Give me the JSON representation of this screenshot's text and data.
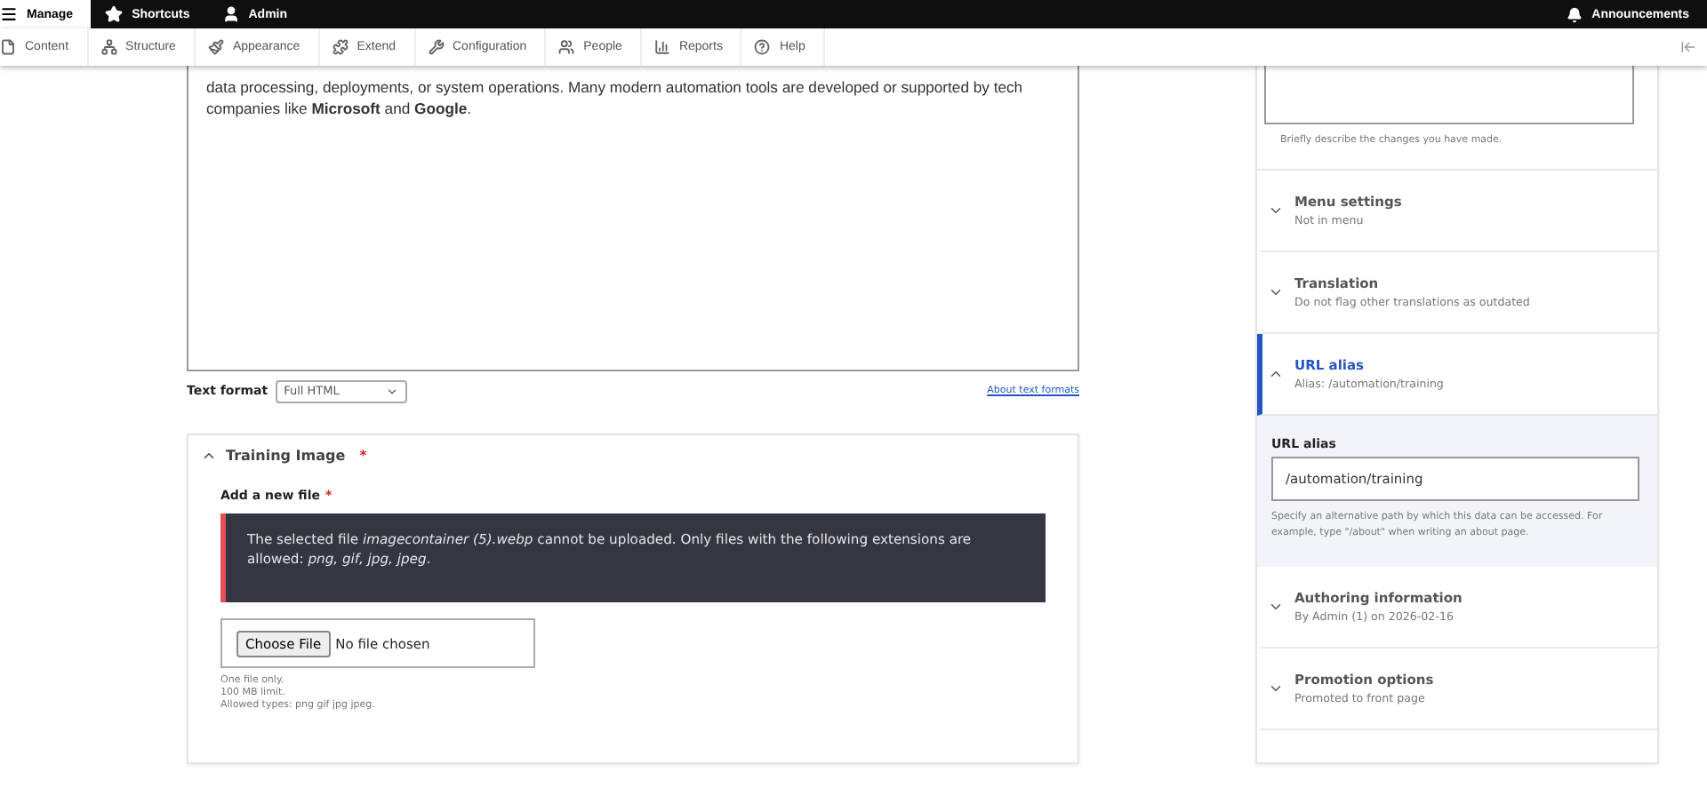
{
  "top_bar": {
    "items": [
      {
        "label": "Manage",
        "kind": "menu",
        "selected": true
      },
      {
        "label": "Shortcuts",
        "kind": "star",
        "selected": false
      },
      {
        "label": "Admin",
        "kind": "user",
        "selected": false
      }
    ],
    "announcements": {
      "label": "Announcements"
    }
  },
  "admin_menu": [
    {
      "label": "Content",
      "kind": "content"
    },
    {
      "label": "Structure",
      "kind": "structure"
    },
    {
      "label": "Appearance",
      "kind": "appearance"
    },
    {
      "label": "Extend",
      "kind": "extend"
    },
    {
      "label": "Configuration",
      "kind": "configuration"
    },
    {
      "label": "People",
      "kind": "people"
    },
    {
      "label": "Reports",
      "kind": "reports"
    },
    {
      "label": "Help",
      "kind": "help"
    }
  ],
  "editor": {
    "text": "data processing, deployments, or system operations. Many modern automation tools are developed or supported by tech companies like **Microsoft** and **Google**."
  },
  "text_format": {
    "label": "Text format",
    "value": "Full HTML",
    "link": "About text formats"
  },
  "training_image": {
    "title": "Training Image",
    "required_marker": "*",
    "expanded": true,
    "field_label": "Add a new file",
    "field_required_marker": "*",
    "error": "The selected file *imagecontainer (5).webp* cannot be uploaded. Only files with the following extensions are allowed: *png, gif, jpg, jpeg*.",
    "button": "Choose File",
    "file_status": "No file chosen",
    "help": [
      "One file only.",
      "100 MB limit.",
      "Allowed types: png gif jpg jpeg."
    ]
  },
  "sidebar": {
    "revision_hint": "Briefly describe the changes you have made.",
    "sections": [
      {
        "title": "Menu settings",
        "summary": "Not in menu",
        "expanded": false
      },
      {
        "title": "Translation",
        "summary": "Do not flag other translations as outdated",
        "expanded": false
      },
      {
        "title": "URL alias",
        "summary": "Alias: /automation/training",
        "expanded": true,
        "field_label": "URL alias",
        "value": "/automation/training",
        "help": "Specify an alternative path by which this data can be accessed. For example, type \"/about\" when writing an about page."
      },
      {
        "title": "Authoring information",
        "summary": "By Admin (1) on 2026-02-16",
        "expanded": false
      },
      {
        "title": "Promotion options",
        "summary": "Promoted to front page",
        "expanded": false
      }
    ]
  }
}
